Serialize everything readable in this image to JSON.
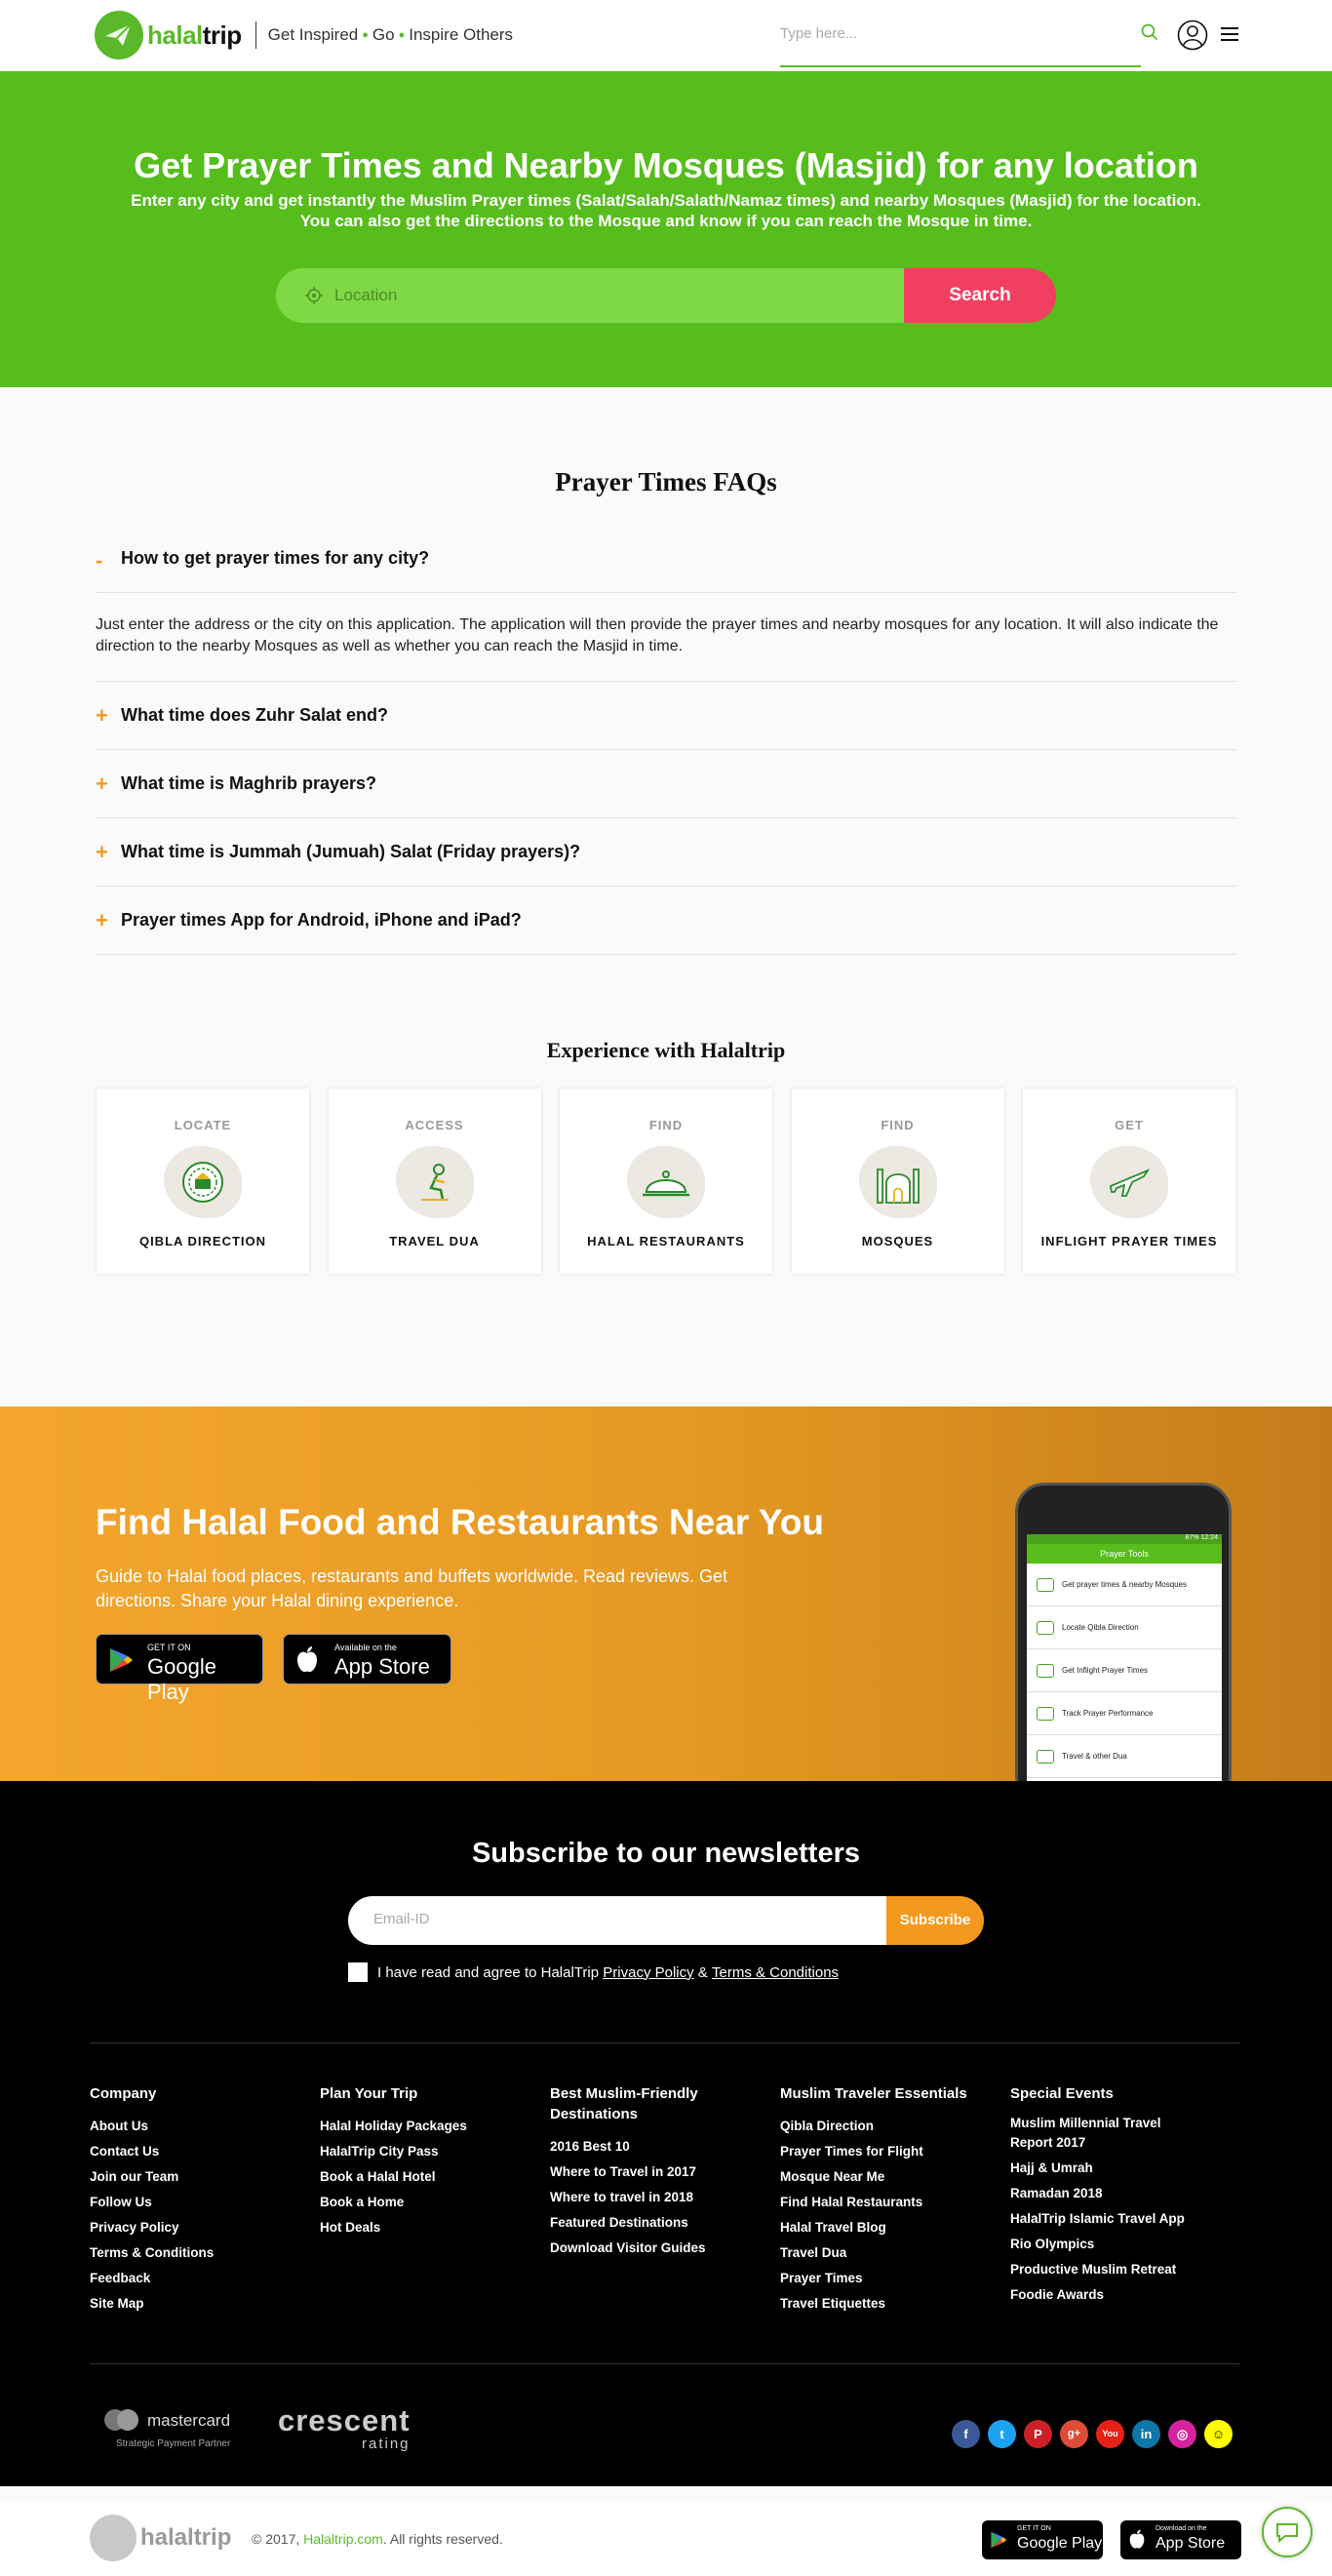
{
  "header": {
    "brand": "halaltrip",
    "brand_prefix": "halal",
    "brand_suffix": "trip",
    "tagline_1": "Get Inspired",
    "tagline_2": "Go",
    "tagline_3": "Inspire Others",
    "search_placeholder": "Type here...",
    "accent": "#5bb82a"
  },
  "hero": {
    "title": "Get Prayer Times and Nearby Mosques (Masjid) for any location",
    "subtitle_1": "Enter any city and get instantly the Muslim Prayer times (Salat/Salah/Salath/Namaz times) and nearby Mosques (Masjid) for the location.",
    "subtitle_2": "You can also get the directions to the Mosque and know if you can reach the Mosque in time.",
    "location_placeholder": "Location",
    "search_button": "Search",
    "bg_color": "#56bd1c",
    "button_color": "#f13f5f"
  },
  "faq": {
    "title": "Prayer Times FAQs",
    "items": [
      {
        "sign": "-",
        "question": "How to get prayer times for any city?",
        "answer": "Just enter the address or the city on this application. The application will then provide the prayer times and nearby mosques for any location. It will also indicate the direction to the nearby Mosques as well as whether you can reach the Masjid in time."
      },
      {
        "sign": "+",
        "question": "What time does Zuhr Salat end?"
      },
      {
        "sign": "+",
        "question": "What time is Maghrib prayers?"
      },
      {
        "sign": "+",
        "question": "What time is Jummah (Jumuah) Salat (Friday prayers)?"
      },
      {
        "sign": "+",
        "question": "Prayer times App for Android, iPhone and iPad?"
      }
    ]
  },
  "experience": {
    "title": "Experience with Halaltrip",
    "cards": [
      {
        "verb": "LOCATE",
        "label": "QIBLA DIRECTION",
        "icon": "qibla-compass-icon"
      },
      {
        "verb": "ACCESS",
        "label": "TRAVEL DUA",
        "icon": "praying-person-icon"
      },
      {
        "verb": "FIND",
        "label": "HALAL RESTAURANTS",
        "icon": "food-cloche-icon"
      },
      {
        "verb": "FIND",
        "label": "MOSQUES",
        "icon": "mosque-icon"
      },
      {
        "verb": "GET",
        "label": "INFLIGHT PRAYER TIMES",
        "icon": "airplane-icon"
      }
    ]
  },
  "promo": {
    "title": "Find Halal Food and Restaurants Near You",
    "text": "Guide to Halal food places, restaurants and buffets worldwide. Read reviews. Get directions. Share your Halal dining experience.",
    "google_small": "GET IT ON",
    "google_big": "Google Play",
    "apple_small": "Available on the",
    "apple_big": "App Store",
    "phone": {
      "status": "87% 12:24",
      "title": "Prayer Tools",
      "rows": [
        "Get prayer times & nearby Mosques",
        "Locate Qibla Direction",
        "Get Inflight Prayer Times",
        "Track Prayer Performance",
        "Travel & other Dua"
      ]
    }
  },
  "subscribe": {
    "title": "Subscribe to our newsletters",
    "email_placeholder": "Email-ID",
    "button": "Subscribe",
    "agree_prefix": "I have read and agree to HalalTrip",
    "privacy": "Privacy Policy",
    "amp": "&",
    "terms": "Terms & Conditions"
  },
  "footer": {
    "columns": [
      {
        "title": "Company",
        "links": [
          "About Us",
          "Contact Us",
          "Join our Team",
          "Follow Us",
          "Privacy Policy",
          "Terms & Conditions",
          "Feedback",
          "Site Map"
        ]
      },
      {
        "title": "Plan Your Trip",
        "links": [
          "Halal Holiday Packages",
          "HalalTrip City Pass",
          "Book a Halal Hotel",
          "Book a Home",
          "Hot Deals"
        ]
      },
      {
        "title": "Best Muslim-Friendly Destinations",
        "links": [
          "2016 Best 10",
          "Where to Travel in 2017",
          "Where to travel in 2018",
          "Featured Destinations",
          "Download Visitor Guides"
        ]
      },
      {
        "title": "Muslim Traveler Essentials",
        "links": [
          "Qibla Direction",
          "Prayer Times for Flight",
          "Mosque Near Me",
          "Find Halal Restaurants",
          "Halal Travel Blog",
          "Travel Dua",
          "Prayer Times",
          "Travel Etiquettes"
        ]
      },
      {
        "title": "Special Events",
        "links": [
          "Muslim Millennial Travel Report 2017",
          "Hajj & Umrah",
          "Ramadan 2018",
          "HalalTrip Islamic Travel App",
          "Rio Olympics",
          "Productive Muslim Retreat",
          "Foodie Awards"
        ]
      }
    ],
    "mastercard": "mastercard",
    "mastercard_sub": "Strategic Payment Partner",
    "crescent": "crescent",
    "crescent_sub": "rating",
    "socials": [
      {
        "icon": "facebook-icon",
        "glyph": "f",
        "color": "#3b5998"
      },
      {
        "icon": "twitter-icon",
        "glyph": "t",
        "color": "#1da1f2"
      },
      {
        "icon": "pinterest-icon",
        "glyph": "P",
        "color": "#cb2027"
      },
      {
        "icon": "google-plus-icon",
        "glyph": "g+",
        "color": "#dd4b39"
      },
      {
        "icon": "youtube-icon",
        "glyph": "You",
        "color": "#e62117"
      },
      {
        "icon": "linkedin-icon",
        "glyph": "in",
        "color": "#0e76a8"
      },
      {
        "icon": "instagram-icon",
        "glyph": "◎",
        "color": "#d6249f"
      },
      {
        "icon": "snapchat-icon",
        "glyph": "☺",
        "color": "#fffc00"
      }
    ]
  },
  "bottom": {
    "brand": "halaltrip",
    "copyright_prefix": "© 2017,",
    "copyright_link": "Halaltrip.com",
    "copyright_suffix": ". All rights reserved.",
    "google_small": "GET IT ON",
    "google_big": "Google Play",
    "apple_small": "Download on the",
    "apple_big": "App Store"
  }
}
